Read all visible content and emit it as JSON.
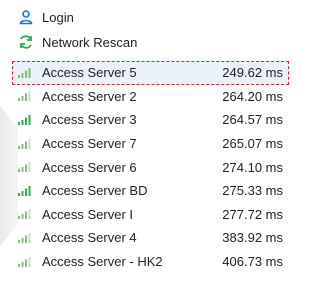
{
  "menu": {
    "login_label": "Login",
    "rescan_label": "Network Rescan",
    "icons": {
      "login": "user-icon",
      "rescan": "refresh-icon"
    },
    "accent_color": "#1a73e8",
    "rescan_color": "#28a745"
  },
  "servers": [
    {
      "name": "Access Server 5",
      "latency": "249.62 ms",
      "signal_bars": 4,
      "selected": true
    },
    {
      "name": "Access Server 2",
      "latency": "264.20 ms",
      "signal_bars": 3
    },
    {
      "name": "Access Server 3",
      "latency": "264.57 ms",
      "signal_bars": 4
    },
    {
      "name": "Access Server 7",
      "latency": "265.07 ms",
      "signal_bars": 3
    },
    {
      "name": "Access Server 6",
      "latency": "274.10 ms",
      "signal_bars": 3
    },
    {
      "name": "Access Server BD",
      "latency": "275.33 ms",
      "signal_bars": 4
    },
    {
      "name": "Access Server I",
      "latency": "277.72 ms",
      "signal_bars": 3
    },
    {
      "name": "Access Server 4",
      "latency": "383.92 ms",
      "signal_bars": 3
    },
    {
      "name": "Access Server - HK2",
      "latency": "406.73 ms",
      "signal_bars": 3
    }
  ]
}
